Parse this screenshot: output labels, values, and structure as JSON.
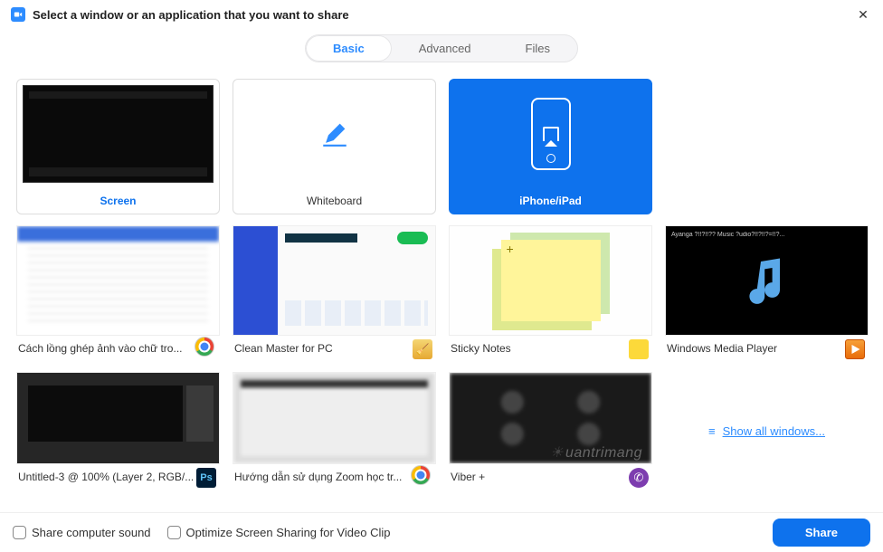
{
  "title": "Select a window or an application that you want to share",
  "tabs": {
    "basic": "Basic",
    "advanced": "Advanced",
    "files": "Files"
  },
  "primary": {
    "screen": "Screen",
    "whiteboard": "Whiteboard",
    "iphone": "iPhone/iPad"
  },
  "apps": [
    {
      "label": "Cách lồng ghép ảnh vào chữ tro...",
      "icon": "chrome"
    },
    {
      "label": "Clean Master for PC",
      "icon": "brush"
    },
    {
      "label": "Sticky Notes",
      "icon": "sticky"
    },
    {
      "label": "Windows Media Player",
      "icon": "wmp",
      "nowplaying": "Ayanga ?!!?!!?? Music ?udio?!!?!!?=!!?..."
    },
    {
      "label": "Untitled-3 @ 100% (Layer 2, RGB/...",
      "icon": "ps"
    },
    {
      "label": "Hướng dẫn sử dụng Zoom học tr...",
      "icon": "chrome"
    },
    {
      "label": "Viber +",
      "icon": "viber"
    }
  ],
  "showall": "Show all windows...",
  "footer": {
    "sound": "Share computer sound",
    "optimize": "Optimize Screen Sharing for Video Clip",
    "share": "Share"
  },
  "watermark": "uantrimang"
}
